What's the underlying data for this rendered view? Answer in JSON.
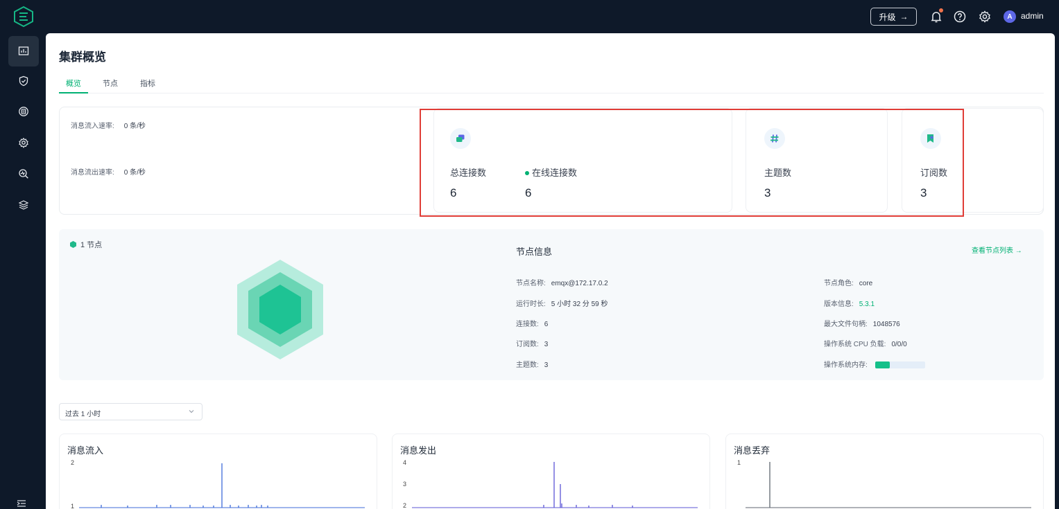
{
  "header": {
    "upgrade_label": "升级",
    "upgrade_arrow": "→",
    "avatar_initial": "A",
    "username": "admin"
  },
  "sidebar": {
    "items": [
      {
        "icon": "dashboard-icon",
        "active": true
      },
      {
        "icon": "shield-icon",
        "active": false
      },
      {
        "icon": "integration-icon",
        "active": false
      },
      {
        "icon": "management-icon",
        "active": false
      },
      {
        "icon": "diagnose-icon",
        "active": false
      },
      {
        "icon": "layers-icon",
        "active": false
      }
    ],
    "collapse_icon": "collapse-icon"
  },
  "page": {
    "title": "集群概览",
    "tabs": [
      "概览",
      "节点",
      "指标"
    ],
    "active_tab": 0
  },
  "rates": {
    "in_label": "消息流入速率:",
    "in_value": "0 条/秒",
    "out_label": "消息流出速率:",
    "out_value": "0 条/秒"
  },
  "stats": {
    "total_connections_label": "总连接数",
    "total_connections_value": "6",
    "online_connections_label": "在线连接数",
    "online_connections_value": "6",
    "topics_label": "主题数",
    "topics_value": "3",
    "subscriptions_label": "订阅数",
    "subscriptions_value": "3"
  },
  "node": {
    "badge": "1 节点",
    "info_title": "节点信息",
    "list_link": "查看节点列表",
    "list_link_arrow": "→",
    "name_label": "节点名称:",
    "name_value": "emqx@172.17.0.2",
    "uptime_label": "运行时长:",
    "uptime_value": "5 小时 32 分 59 秒",
    "connections_label": "连接数:",
    "connections_value": "6",
    "subscriptions_label": "订阅数:",
    "subscriptions_value": "3",
    "topics_label": "主题数:",
    "topics_value": "3",
    "role_label": "节点角色:",
    "role_value": "core",
    "version_label": "版本信息:",
    "version_value": "5.3.1",
    "max_fds_label": "最大文件句柄:",
    "max_fds_value": "1048576",
    "cpu_load_label": "操作系统 CPU 负载:",
    "cpu_load_value": "0/0/0",
    "memory_label": "操作系统内存:",
    "memory_fraction": 0.3
  },
  "range": {
    "selected": "过去 1 小时"
  },
  "charts": [
    {
      "title": "消息流入",
      "ticks": [
        "2",
        "1"
      ],
      "color": "#3d6bd8"
    },
    {
      "title": "消息发出",
      "ticks": [
        "4",
        "3",
        "2"
      ],
      "color": "#5b54d6"
    },
    {
      "title": "消息丢弃",
      "ticks": [
        "1"
      ],
      "color": "#5f6670"
    }
  ],
  "colors": {
    "accent": "#00b173",
    "highlight": "#e03c36",
    "sidebar_bg": "#0e1929"
  }
}
